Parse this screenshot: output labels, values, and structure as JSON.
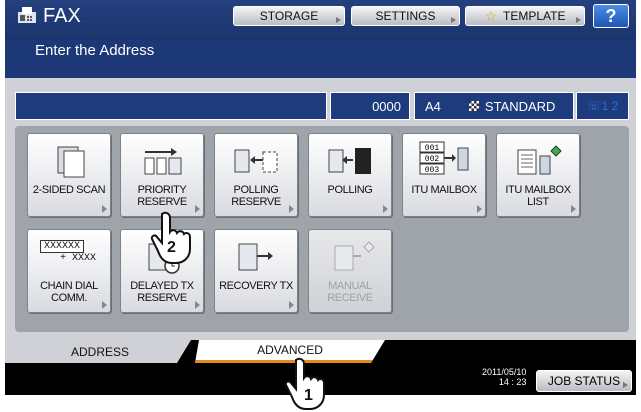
{
  "header": {
    "app_title": "FAX",
    "subtitle": "Enter the Address",
    "storage_label": "STORAGE",
    "settings_label": "SETTINGS",
    "template_label": "TEMPLATE",
    "help_label": "?"
  },
  "info": {
    "count": "0000",
    "paper_size": "A4",
    "resolution": "STANDARD",
    "lines": "1 2"
  },
  "tiles": [
    {
      "label": "2-SIDED SCAN",
      "icon": "two-sided-scan-icon"
    },
    {
      "label": "PRIORITY RESERVE",
      "icon": "priority-reserve-icon"
    },
    {
      "label": "POLLING RESERVE",
      "icon": "polling-reserve-icon"
    },
    {
      "label": "POLLING",
      "icon": "polling-icon"
    },
    {
      "label": "ITU MAILBOX",
      "icon": "itu-mailbox-icon",
      "icon_text": [
        "001",
        "002",
        "003"
      ]
    },
    {
      "label": "ITU MAILBOX LIST",
      "icon": "itu-mailbox-list-icon"
    },
    {
      "label": "CHAIN DIAL COMM.",
      "icon": "chain-dial-icon",
      "icon_text": [
        "XXXXXX",
        "+ XXXX"
      ]
    },
    {
      "label": "DELAYED TX RESERVE",
      "icon": "delayed-tx-icon"
    },
    {
      "label": "RECOVERY TX",
      "icon": "recovery-tx-icon"
    },
    {
      "label": "MANUAL RECEIVE",
      "icon": "manual-receive-icon",
      "disabled": true
    }
  ],
  "tabs": {
    "address": "ADDRESS",
    "advanced": "ADVANCED"
  },
  "footer": {
    "date": "2011/05/10",
    "time": "14 : 23",
    "job_status": "JOB STATUS"
  },
  "callouts": [
    "1",
    "2"
  ],
  "colors": {
    "header_blue": "#1d3876",
    "accent_orange": "#e88a1a",
    "help_blue": "#1b56b3"
  }
}
